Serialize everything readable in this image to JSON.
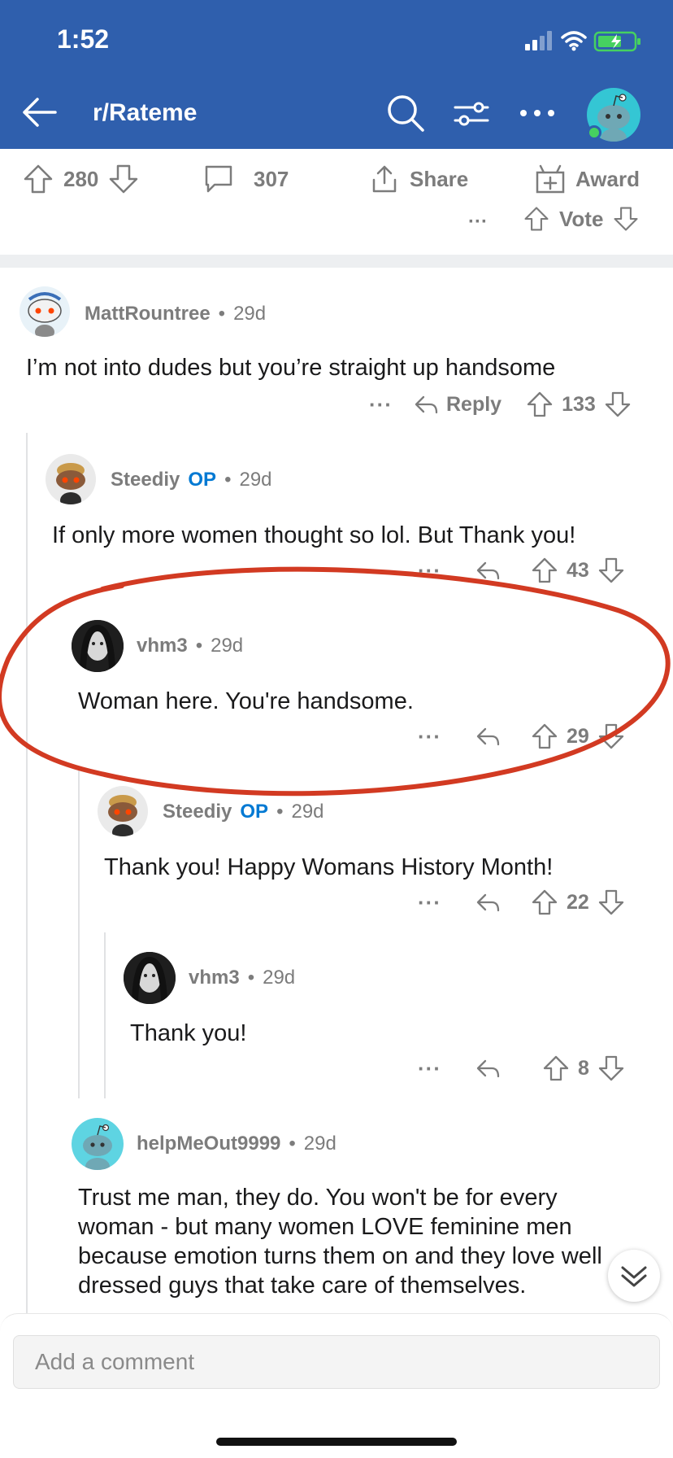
{
  "status_bar": {
    "time": "1:52"
  },
  "nav": {
    "title": "r/Rateme"
  },
  "actions": {
    "post_votes": "280",
    "comment_count": "307",
    "share_label": "Share",
    "award_label": "Award",
    "vote_label": "Vote"
  },
  "comments": [
    {
      "user": "MattRountree",
      "op": "",
      "age": "29d",
      "body": "I’m not into dudes but you’re straight up handsome",
      "reply_label": "Reply",
      "score": "133"
    },
    {
      "user": "Steediy",
      "op": "OP",
      "age": "29d",
      "body": "If only more women thought so lol. But Thank you!",
      "score": "43"
    },
    {
      "user": "vhm3",
      "op": "",
      "age": "29d",
      "body": "Woman here. You're handsome.",
      "score": "29"
    },
    {
      "user": "Steediy",
      "op": "OP",
      "age": "29d",
      "body": "Thank you!  Happy Womans History Month!",
      "score": "22"
    },
    {
      "user": "vhm3",
      "op": "",
      "age": "29d",
      "body": "Thank you!",
      "score": "8"
    },
    {
      "user": "helpMeOut9999",
      "op": "",
      "age": "29d",
      "body": "Trust me man, they do.  You won't be for every woman - but many women LOVE feminine men because emotion turns them on and they love well dressed guys that take care of themselves."
    }
  ],
  "composer": {
    "placeholder": "Add a comment"
  },
  "colors": {
    "header_bg": "#2f5fad",
    "op_blue": "#0079d3",
    "annotation_red": "#d23a22"
  },
  "separator": "•",
  "more_dots": "···"
}
